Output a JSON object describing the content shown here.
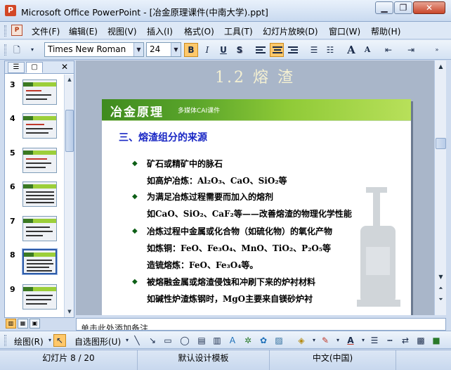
{
  "window": {
    "title": "Microsoft Office PowerPoint - [冶金原理课件(中南大学).ppt]",
    "app_icon": "P",
    "controls": [
      "minimize-icon",
      "restore-icon",
      "close-icon"
    ]
  },
  "menubar": {
    "items": [
      "文件(F)",
      "编辑(E)",
      "视图(V)",
      "插入(I)",
      "格式(O)",
      "工具(T)",
      "幻灯片放映(D)",
      "窗口(W)",
      "帮助(H)"
    ]
  },
  "toolbar": {
    "font_name": "Times New Roman",
    "font_size": "24",
    "bold": "B",
    "italic": "I",
    "underline": "U",
    "shadow": "S",
    "grow_font": "A",
    "shrink_font": "A",
    "active_color": "#ffc86a"
  },
  "left_pane": {
    "thumbnails": [
      {
        "number": "3",
        "selected": false
      },
      {
        "number": "4",
        "selected": false
      },
      {
        "number": "5",
        "selected": false
      },
      {
        "number": "6",
        "selected": false
      },
      {
        "number": "7",
        "selected": false
      },
      {
        "number": "8",
        "selected": true
      },
      {
        "number": "9",
        "selected": false
      }
    ]
  },
  "slide": {
    "section_title": "1.2 熔 渣",
    "logo_text": "冶金原理",
    "logo_subtitle": "多媒体CAI课件",
    "heading": "三、熔渣组分的来源",
    "lines": [
      {
        "bullet": true,
        "text": "矿石或精矿中的脉石"
      },
      {
        "bullet": false,
        "text": "如高炉冶炼：Al₂O₃、CaO、SiO₂等"
      },
      {
        "bullet": true,
        "text": "为满足冶炼过程需要而加入的熔剂"
      },
      {
        "bullet": false,
        "text": "如CaO、SiO₂、CaF₂等——改善熔渣的物理化学性能"
      },
      {
        "bullet": true,
        "text": "冶炼过程中金属或化合物（如硫化物）的氧化产物"
      },
      {
        "bullet": false,
        "text": "如炼铜：FeO、Fe₃O₄、MnO、TiO₂、P₂O₅等"
      },
      {
        "bullet": false,
        "text": "造锍熔炼：FeO、Fe₃O₄等。"
      },
      {
        "bullet": true,
        "text": "被熔融金属或熔渣侵蚀和冲刷下来的炉衬材料"
      },
      {
        "bullet": false,
        "text": "如碱性炉渣炼钢时，MgO主要来自镁砂炉衬"
      }
    ],
    "colors": {
      "heading": "#1826c4",
      "header_band": "#5aa52a",
      "bullet": "#0d5f16"
    }
  },
  "notes": {
    "placeholder": "单击此处添加备注"
  },
  "drawbar": {
    "draw_label": "绘图(R)",
    "autoshape_label": "自选图形(U)"
  },
  "statusbar": {
    "slide_info": "幻灯片 8 / 20",
    "design": "默认设计模板",
    "language": "中文(中国)"
  }
}
